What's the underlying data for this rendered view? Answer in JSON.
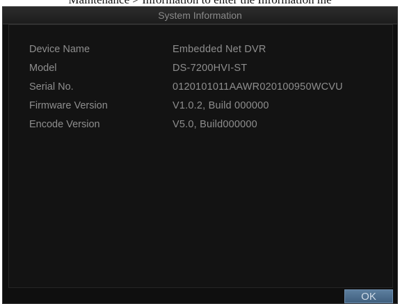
{
  "document": {
    "caption": "Maintenance > Information to enter the Information me"
  },
  "dialog": {
    "title": "System Information",
    "rows": [
      {
        "label": "Device Name",
        "value": "Embedded Net DVR"
      },
      {
        "label": "Model",
        "value": "DS-7200HVI-ST"
      },
      {
        "label": "Serial No.",
        "value": "0120101011AAWR020100950WCVU"
      },
      {
        "label": "Firmware Version",
        "value": "V1.0.2, Build 000000"
      },
      {
        "label": "Encode Version",
        "value": "V5.0, Build000000"
      }
    ],
    "ok_label": "OK"
  },
  "colors": {
    "dialog_background": "#0f0f0f",
    "text": "#8e8e8e",
    "button": "#4f7090"
  }
}
